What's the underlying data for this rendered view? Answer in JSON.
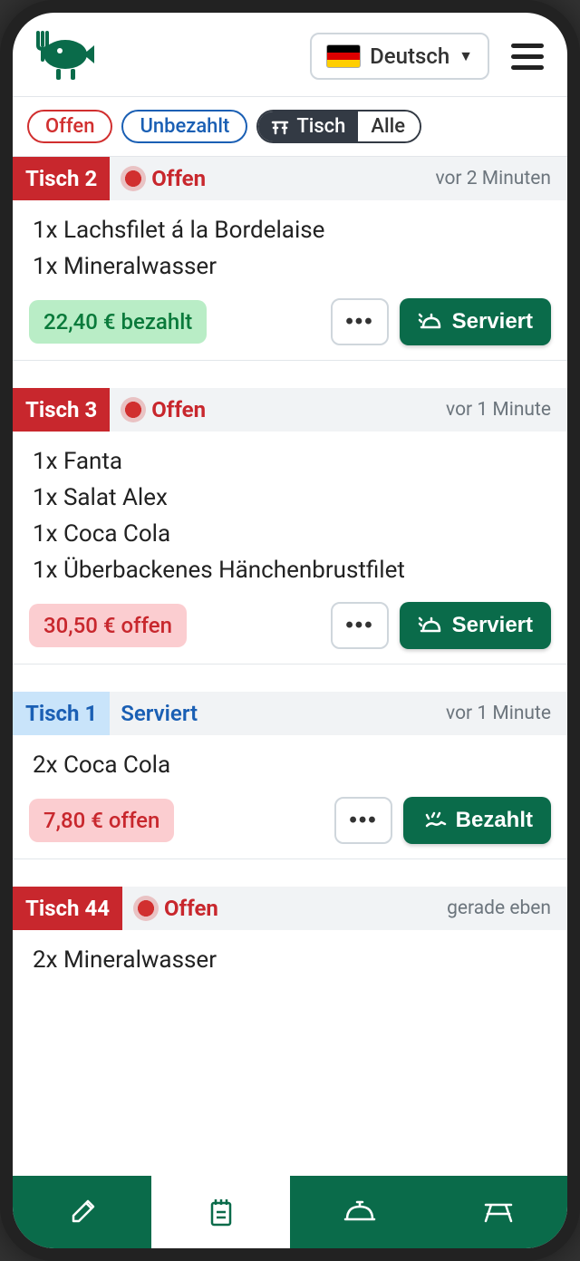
{
  "header": {
    "language_label": "Deutsch"
  },
  "filters": {
    "open": "Offen",
    "unpaid": "Unbezahlt",
    "table": "Tisch",
    "all": "Alle"
  },
  "orders": [
    {
      "table": "Tisch 2",
      "table_style": "red",
      "status": "Offen",
      "status_style": "red",
      "time": "vor 2 Minuten",
      "items": [
        "1x Lachsfilet á la Bordelaise",
        "1x Mineralwasser"
      ],
      "price_text": "22,40 € bezahlt",
      "price_style": "green",
      "action_label": "Serviert",
      "action_icon": "serve"
    },
    {
      "table": "Tisch 3",
      "table_style": "red",
      "status": "Offen",
      "status_style": "red",
      "time": "vor 1 Minute",
      "items": [
        "1x Fanta",
        "1x Salat Alex",
        "1x Coca Cola",
        "1x Überbackenes Hänchenbrustfilet"
      ],
      "price_text": "30,50 € offen",
      "price_style": "red",
      "action_label": "Serviert",
      "action_icon": "serve"
    },
    {
      "table": "Tisch 1",
      "table_style": "blue",
      "status": "Serviert",
      "status_style": "blue",
      "time": "vor 1 Minute",
      "items": [
        "2x Coca Cola"
      ],
      "price_text": "7,80 € offen",
      "price_style": "red",
      "action_label": "Bezahlt",
      "action_icon": "pay"
    },
    {
      "table": "Tisch 44",
      "table_style": "red",
      "status": "Offen",
      "status_style": "red",
      "time": "gerade eben",
      "items": [
        "2x Mineralwasser"
      ],
      "price_text": "",
      "price_style": "",
      "action_label": "",
      "action_icon": ""
    }
  ]
}
